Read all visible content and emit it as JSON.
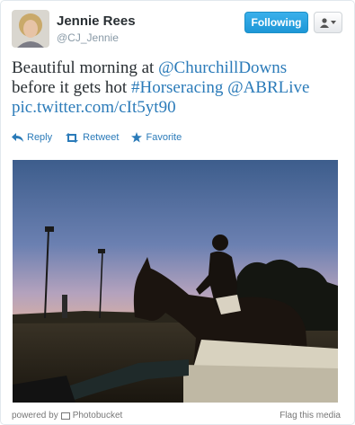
{
  "author": {
    "name": "Jennie Rees",
    "handle": "@CJ_Jennie"
  },
  "header": {
    "follow_label": "Following"
  },
  "tweet": {
    "line1_text": "Beautiful morning at ",
    "mention1": "@ChurchillDowns",
    "line2_text": "before it gets hot ",
    "hashtag": "#Horseracing",
    "mention2": "@ABRLive",
    "pic_link": "pic.twitter.com/cIt5yt90"
  },
  "actions": {
    "reply": "Reply",
    "retweet": "Retweet",
    "favorite": "Favorite"
  },
  "footer": {
    "powered_by": "powered by",
    "provider": "Photobucket",
    "flag": "Flag this media"
  },
  "colors": {
    "link": "#2b7bb9",
    "follow_button": "#1d97d7"
  }
}
